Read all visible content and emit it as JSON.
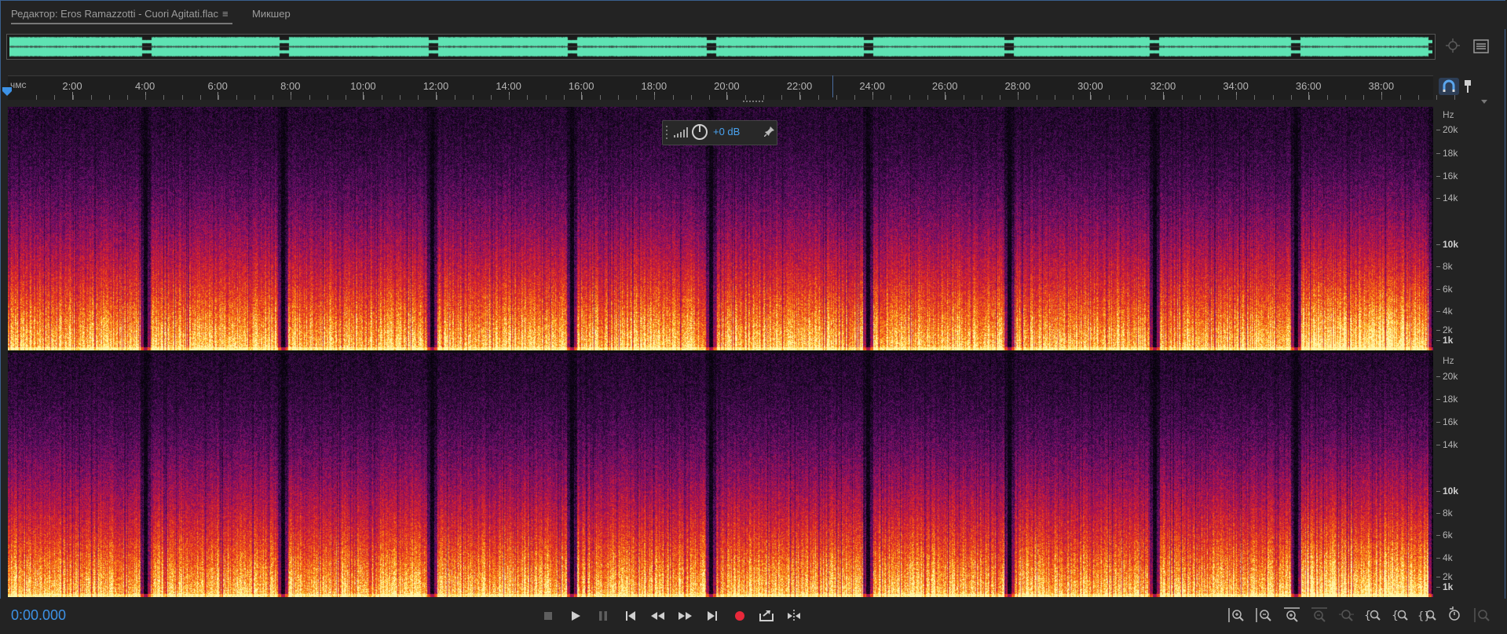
{
  "tabs": [
    {
      "label": "Редактор: Eros Ramazzotti - Cuori Agitati.flac",
      "active": true
    },
    {
      "label": "Микшер",
      "active": false
    }
  ],
  "ruler": {
    "unit_label": "чмс",
    "labels": [
      "2:00",
      "4:00",
      "6:00",
      "8:00",
      "10:00",
      "12:00",
      "14:00",
      "16:00",
      "18:00",
      "20:00",
      "22:00",
      "24:00",
      "26:00",
      "28:00",
      "30:00",
      "32:00",
      "34:00",
      "36:00",
      "38:00"
    ]
  },
  "hud": {
    "volume": "+0 dB"
  },
  "freq_axis": {
    "unit": "Hz",
    "labels": [
      {
        "text": "20k",
        "bold": false
      },
      {
        "text": "18k",
        "bold": false
      },
      {
        "text": "16k",
        "bold": false
      },
      {
        "text": "14k",
        "bold": false
      },
      {
        "text": "10k",
        "bold": true
      },
      {
        "text": "8k",
        "bold": false
      },
      {
        "text": "6k",
        "bold": false
      },
      {
        "text": "4k",
        "bold": false
      },
      {
        "text": "2k",
        "bold": false
      },
      {
        "text": "1k",
        "bold": true
      }
    ],
    "channels": 2
  },
  "transport": {
    "time": "0:00.000",
    "buttons": [
      "stop",
      "play",
      "pause",
      "go-to-start",
      "rewind",
      "fast-forward",
      "go-to-end",
      "record",
      "loop",
      "skip-selection"
    ]
  },
  "zoom_tools": [
    "zoom-in-amplitude",
    "zoom-out-amplitude",
    "zoom-in-time",
    "zoom-out-time",
    "zoom-out-full",
    "zoom-in-selection",
    "zoom-in-left-edge",
    "zoom-in-right-edge",
    "zoom-to-selection",
    "zoom-reset",
    "zoom-in-all-tracks"
  ],
  "colors": {
    "accent_blue": "#3d92e6",
    "waveform_green": "#5ee3b3",
    "background": "#232323"
  }
}
